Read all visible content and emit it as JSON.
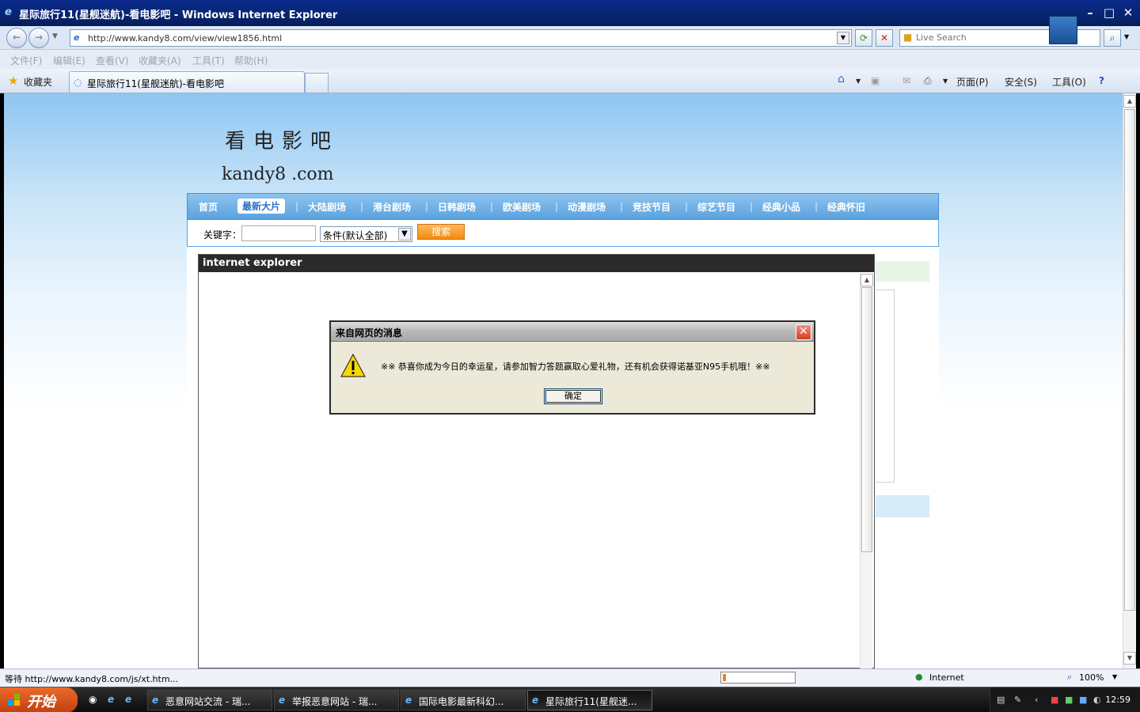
{
  "window": {
    "title": "星际旅行11(星舰迷航)-看电影吧 - Windows Internet Explorer"
  },
  "address": {
    "url": "http://www.kandy8.com/view/view1856.html",
    "search_placeholder": "Live Search"
  },
  "menu": [
    "文件(F)",
    "编辑(E)",
    "查看(V)",
    "收藏夹(A)",
    "工具(T)",
    "帮助(H)"
  ],
  "favorites": {
    "label": "收藏夹",
    "tab_title": "星际旅行11(星舰迷航)-看电影吧"
  },
  "toolbar": {
    "page": "页面(P)",
    "safety": "安全(S)",
    "tools": "工具(O)"
  },
  "site": {
    "logo_cn": "看电影吧",
    "logo_en": "kandy8   .com",
    "nav": [
      "首页",
      "最新大片",
      "大陆剧场",
      "港台剧场",
      "日韩剧场",
      "欧美剧场",
      "动漫剧场",
      "竞技节目",
      "综艺节目",
      "经典小品",
      "经典怀旧"
    ],
    "active_nav": "最新大片",
    "keyword_label": "关键字：",
    "condition": "条件(默认全部)",
    "search_btn": "搜索"
  },
  "popup": {
    "title": "internet explorer"
  },
  "dialog": {
    "title": "来自网页的消息",
    "message": "※※ 恭喜你成为今日的幸运星，请参加智力答题赢取心爱礼物，还有机会获得诺基亚N95手机哦！※※",
    "ok": "确定"
  },
  "status": {
    "text": "等待 http://www.kandy8.com/js/xt.htm...",
    "zone": "Internet",
    "zoom": "100%",
    "progress": 0.04
  },
  "taskbar": {
    "start": "开始",
    "items": [
      "恶意网站交流 - 瑞...",
      "举报恶意网站 - 瑞...",
      "国际电影最新科幻...",
      "星际旅行11(星舰迷..."
    ],
    "clock": "12:59"
  },
  "colors": {
    "accent": "#5aa3df",
    "search_btn": "#f28a10",
    "title_bar": "#0a2a8c"
  }
}
